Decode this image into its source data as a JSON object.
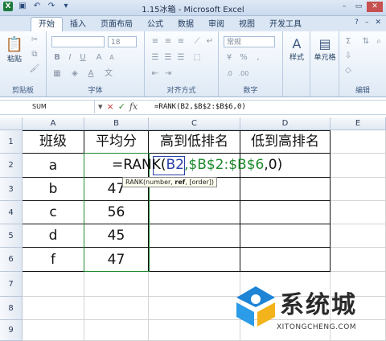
{
  "window": {
    "title": "1.15冰箱 - Microsoft Excel",
    "controls": [
      "–",
      "▭",
      "✕"
    ]
  },
  "ribbon_tabs": [
    "开始",
    "插入",
    "页面布局",
    "公式",
    "数据",
    "审阅",
    "视图",
    "开发工具"
  ],
  "ribbon": {
    "paste_label": "粘贴",
    "clipboard_label": "剪贴板",
    "font_label": "字体",
    "font_size": "18",
    "align_label": "对齐方式",
    "number_format": "常规",
    "number_label": "数字",
    "styles_label": "样式",
    "cells_label": "单元格",
    "editing_label": "编辑"
  },
  "formula_bar": {
    "name_box": "SUM",
    "icons": [
      "▾",
      "×",
      "✓",
      "fx"
    ],
    "formula": "=RANK(B2,$B$2:$B$6,0)"
  },
  "columns": [
    "A",
    "B",
    "C",
    "D",
    "E"
  ],
  "rows": [
    "1",
    "2",
    "3",
    "4",
    "5",
    "6",
    "7",
    "8",
    "9"
  ],
  "cells": {
    "A1": "班级",
    "B1": "平均分",
    "C1": "高到低排名",
    "D1": "低到高排名",
    "A2": "a",
    "A3": "b",
    "B3": "47",
    "A4": "c",
    "B4": "56",
    "A5": "d",
    "B5": "45",
    "A6": "f",
    "B6": "47"
  },
  "editor": {
    "prefix": "=RANK(",
    "ref1": "B2",
    "comma1": ",",
    "ref2": "$B$2:$B$6",
    "suffix": ",0)"
  },
  "tooltip": {
    "pre": "RANK(number, ",
    "bold": "ref",
    "post": ", [order])"
  },
  "watermark": {
    "brand": "系统城",
    "url": "XITONGCHENG.COM"
  }
}
